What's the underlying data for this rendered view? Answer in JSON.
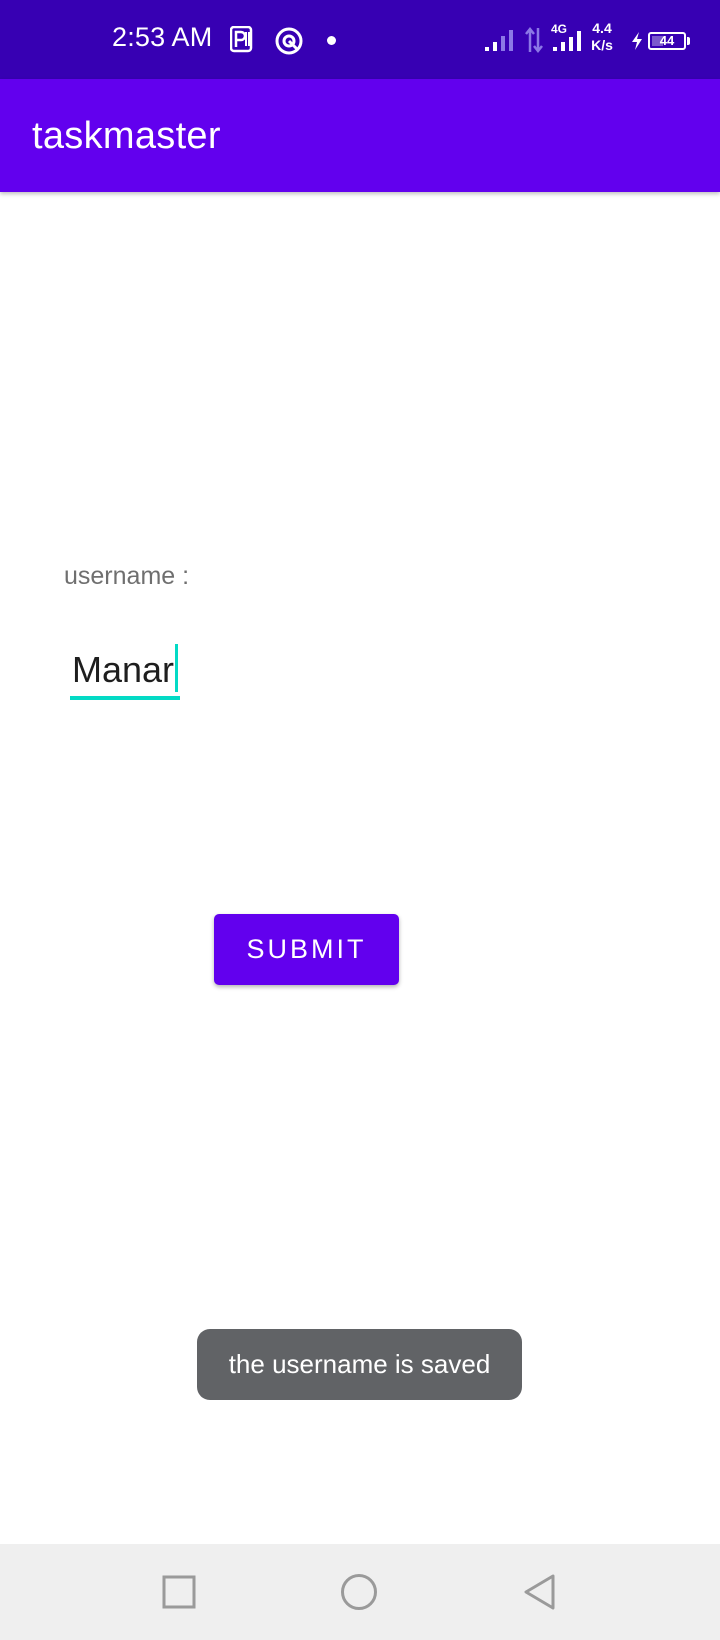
{
  "status_bar": {
    "time": "2:53 AM",
    "network_type": "4G",
    "net_speed_value": "4.4",
    "net_speed_unit": "K/s",
    "battery_level": "44",
    "battery_fraction": 0.44,
    "icons": [
      "parking-icon",
      "location-ring-icon",
      "notification-dot",
      "signal-icon",
      "data-arrows-icon",
      "signal-4g-icon",
      "charging-icon",
      "battery-icon"
    ]
  },
  "app_bar": {
    "title": "taskmaster"
  },
  "form": {
    "username_label": "username :",
    "username_value": "Manar",
    "submit_label": "SUBMIT"
  },
  "toast": {
    "message": "the username is saved"
  },
  "nav_bar": {
    "icons": [
      "recents-square-icon",
      "home-circle-icon",
      "back-triangle-icon"
    ]
  },
  "colors": {
    "status_bar": "#3700b3",
    "primary": "#6200ee",
    "accent": "#03dac5",
    "toast_bg": "#616366",
    "nav_bar_bg": "#efefef"
  }
}
